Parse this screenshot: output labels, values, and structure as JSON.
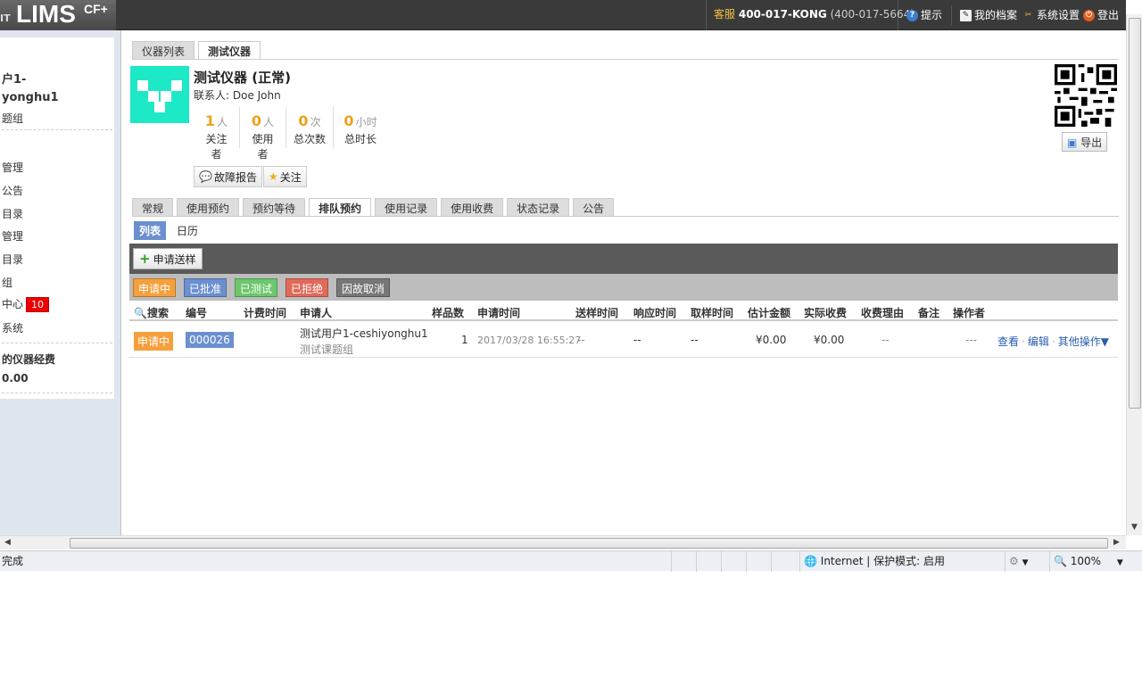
{
  "header": {
    "logo_prefix": "IT",
    "logo": "LIMS",
    "logo_sup": "CF+",
    "hotline_label": "客服",
    "hotline_number": "400-017-KONG",
    "hotline_alt": "(400-017-5664)",
    "nav": [
      "提示",
      "我的档案",
      "系统设置",
      "登出"
    ]
  },
  "sidebar": {
    "user_line1": "户1-",
    "user_line2": "yonghu1",
    "group": "题组",
    "items": [
      "管理",
      "公告",
      "目录",
      "管理",
      "目录",
      "组",
      "中心",
      "系统"
    ],
    "badge": "10",
    "fee_title": "的仪器经费",
    "fee_value": "0.00"
  },
  "tabs": [
    "仪器列表",
    "测试仪器"
  ],
  "instrument": {
    "title": "测试仪器 (正常)",
    "contact": "联系人: Doe John",
    "stats": [
      {
        "num": "1",
        "unit": "人",
        "label": "关注者"
      },
      {
        "num": "0",
        "unit": "人",
        "label": "使用者"
      },
      {
        "num": "0",
        "unit": "次",
        "label": "总次数"
      },
      {
        "num": "0",
        "unit": "小时",
        "label": "总时长"
      }
    ],
    "report_btn": "故障报告",
    "follow_btn": "关注",
    "export_btn": "导出"
  },
  "subtabs": [
    "常规",
    "使用预约",
    "预约等待",
    "排队预约",
    "使用记录",
    "使用收费",
    "状态记录",
    "公告"
  ],
  "viewtabs": [
    "列表",
    "日历"
  ],
  "apply_btn": "申请送样",
  "filters": [
    {
      "label": "申请中",
      "color": "#f5a03c"
    },
    {
      "label": "已批准",
      "color": "#6b8fcf"
    },
    {
      "label": "已测试",
      "color": "#6cc76c"
    },
    {
      "label": "已拒绝",
      "color": "#e06a5a"
    },
    {
      "label": "因故取消",
      "color": "#777777"
    }
  ],
  "table": {
    "headers": [
      "搜索",
      "编号",
      "计费时间",
      "申请人",
      "样品数",
      "申请时间",
      "送样时间",
      "响应时间",
      "取样时间",
      "估计金额",
      "实际收费",
      "收费理由",
      "备注",
      "操作者"
    ],
    "row": {
      "status": "申请中",
      "id": "000026",
      "applicant": "测试用户1-ceshiyonghu1",
      "group": "测试课题组",
      "samples": "1",
      "apply_time": "2017/03/28 16:55:27",
      "send_time": "--",
      "resp_time": "--",
      "take_time": "--",
      "est_amount": "¥0.00",
      "actual": "¥0.00",
      "reason": "--",
      "operator": "---",
      "actions": [
        "查看",
        "编辑",
        "其他操作▼"
      ]
    }
  },
  "statusbar": {
    "left": "完成",
    "zone": "Internet | 保护模式: 启用",
    "zoom": "100%"
  }
}
